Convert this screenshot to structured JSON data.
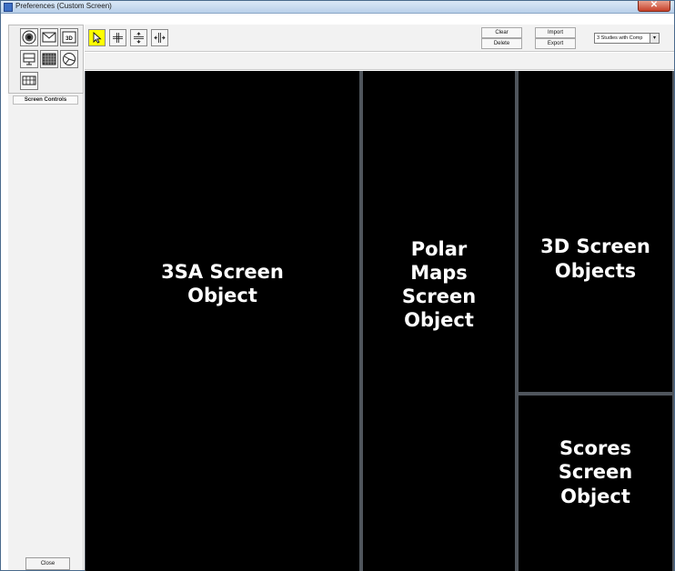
{
  "window": {
    "title": "Preferences (Custom Screen)",
    "close_glyph": "✕"
  },
  "left_panel": {
    "tools": [
      {
        "name": "target-icon"
      },
      {
        "name": "envelope-icon"
      },
      {
        "name": "3d-icon",
        "label": "3D"
      },
      {
        "name": "monitor-icon"
      },
      {
        "name": "grid-icon"
      },
      {
        "name": "pie-icon"
      },
      {
        "name": "table-icon"
      }
    ],
    "screen_controls_label": "Screen Controls",
    "close_label": "Close"
  },
  "toolbar": {
    "modes": [
      {
        "name": "pointer-icon",
        "active": true
      },
      {
        "name": "split-cross-icon"
      },
      {
        "name": "split-vertical-icon"
      },
      {
        "name": "split-horizontal-icon"
      }
    ],
    "clear_label": "Clear",
    "delete_label": "Delete",
    "import_label": "Import",
    "export_label": "Export",
    "layout_select_value": "3 Studies with Comp"
  },
  "screen_objects": {
    "three_sa": "3SA Screen Object",
    "polar_maps": "Polar Maps Screen Object",
    "three_d": "3D Screen Objects",
    "scores": "Scores Screen Object"
  },
  "colors": {
    "active_tool": "#ffff00",
    "canvas_object": "#000000"
  }
}
